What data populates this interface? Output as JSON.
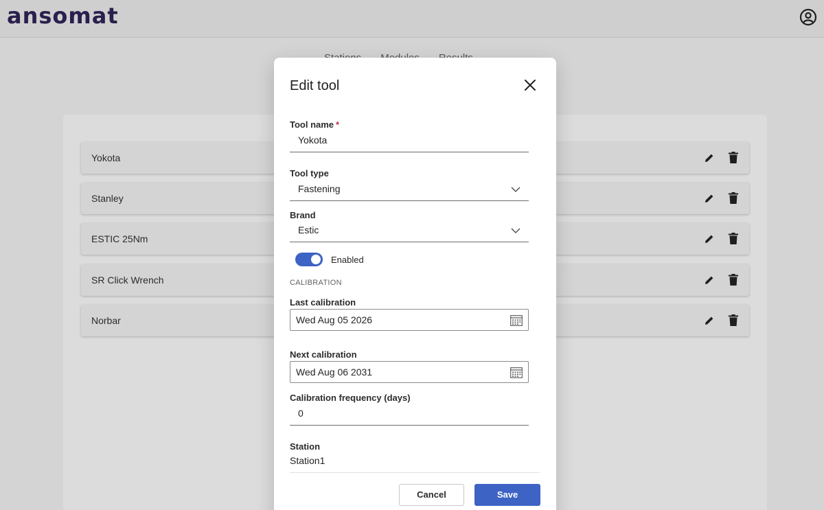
{
  "app": {
    "logo_text": "ansomat",
    "account_icon": "user-circle-icon"
  },
  "background": {
    "nav_links": [
      "Stations",
      "Modules",
      "Results"
    ],
    "tools": [
      {
        "name": "Yokota"
      },
      {
        "name": "Stanley"
      },
      {
        "name": "ESTIC 25Nm"
      },
      {
        "name": "SR Click Wrench"
      },
      {
        "name": "Norbar"
      }
    ],
    "row_actions": {
      "edit_icon": "pencil-icon",
      "delete_icon": "trash-icon"
    }
  },
  "modal": {
    "title": "Edit tool",
    "close_icon": "close-icon",
    "tool_name": {
      "label": "Tool name",
      "required_mark": "*",
      "value": "Yokota"
    },
    "tool_type": {
      "label": "Tool type",
      "value": "Fastening"
    },
    "brand": {
      "label": "Brand",
      "value": "Estic"
    },
    "enabled": {
      "label": "Enabled",
      "on": true
    },
    "calibration_section": "CALIBRATION",
    "last_calibration": {
      "label": "Last calibration",
      "value": "Wed Aug 05 2026"
    },
    "next_calibration": {
      "label": "Next calibration",
      "value": "Wed Aug 06 2031"
    },
    "calibration_frequency": {
      "label": "Calibration frequency (days)",
      "value": "0"
    },
    "station": {
      "label": "Station",
      "value": "Station1"
    },
    "buttons": {
      "cancel": "Cancel",
      "save": "Save"
    }
  },
  "colors": {
    "accent": "#3d63c4",
    "required": "#c4314b",
    "logo": "#2a1f4d"
  }
}
